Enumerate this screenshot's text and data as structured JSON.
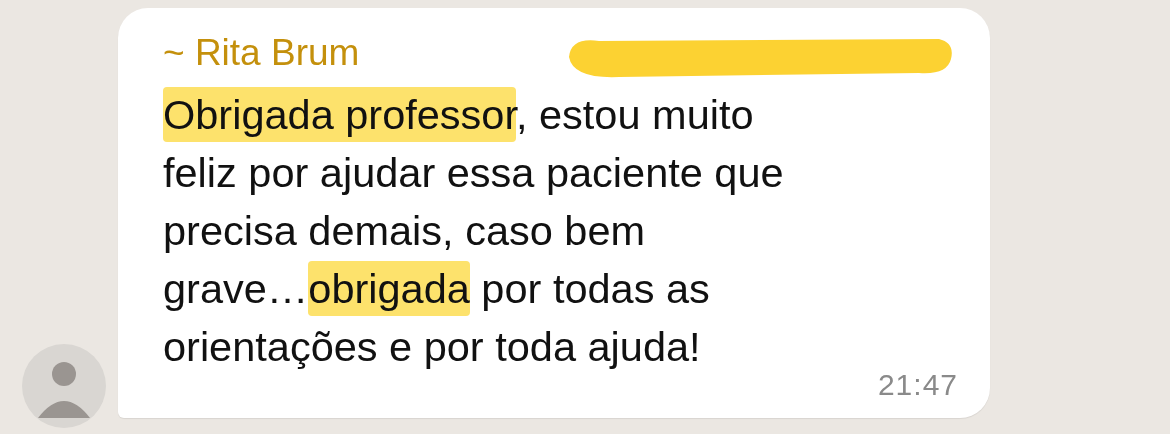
{
  "message": {
    "sender": "~ Rita Brum",
    "sender_number_redacted": true,
    "lines": [
      [
        {
          "text": "Obrigada professor",
          "highlighted": true
        },
        {
          "text": ", estou muito",
          "highlighted": false
        }
      ],
      [
        {
          "text": "feliz por ajudar essa paciente que",
          "highlighted": false
        }
      ],
      [
        {
          "text": "precisa demais, caso bem",
          "highlighted": false
        }
      ],
      [
        {
          "text": "grave…",
          "highlighted": false
        },
        {
          "text": "obrigada",
          "highlighted": true
        },
        {
          "text": " por todas as",
          "highlighted": false
        }
      ],
      [
        {
          "text": "orientações e por toda ajuda!",
          "highlighted": false
        }
      ]
    ],
    "time": "21:47"
  }
}
